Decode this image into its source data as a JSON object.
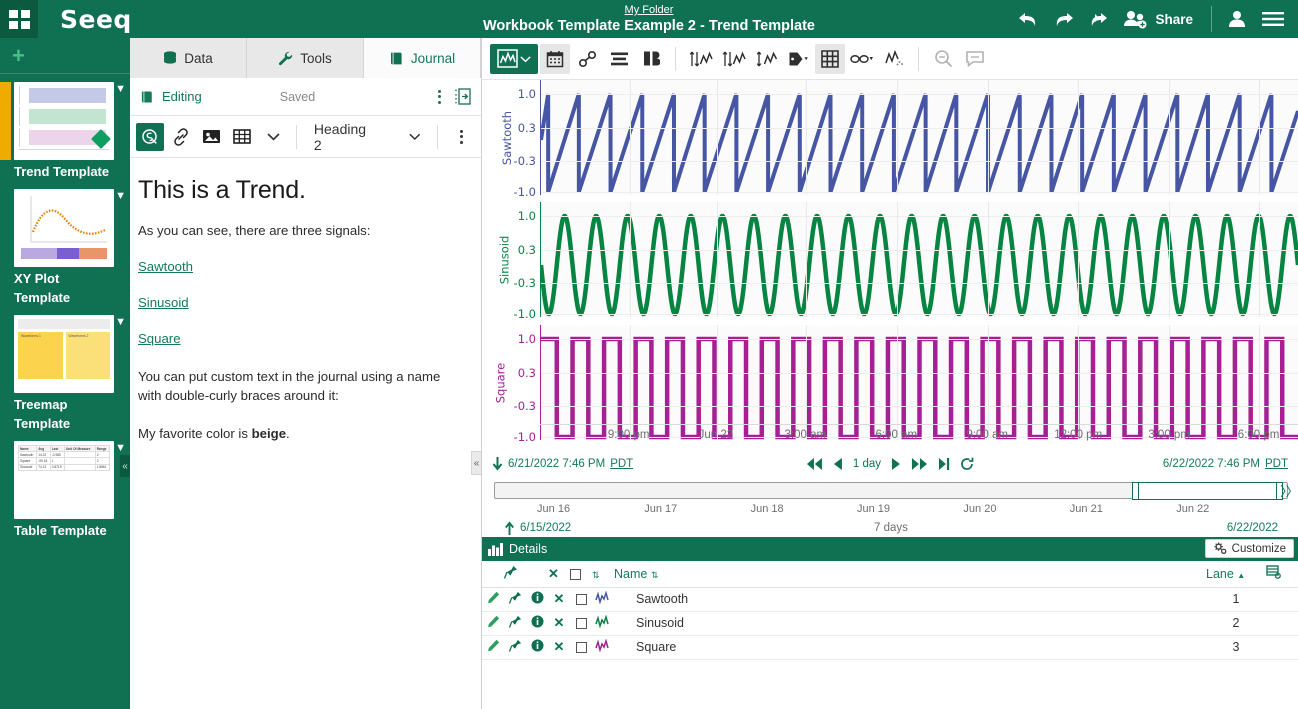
{
  "header": {
    "brand": "Seeq",
    "folder_link": "My Folder",
    "workbook_title": "Workbook Template Example 2 - Trend Template",
    "share_label": "Share",
    "icons": [
      "grid-icon",
      "undo-icon",
      "redo-icon",
      "redo-all-icon",
      "share-users-icon",
      "user-icon",
      "hamburger-icon"
    ]
  },
  "rail": {
    "add_label": "+",
    "templates": [
      {
        "label": "Trend Template",
        "active": true,
        "thumb": "trend"
      },
      {
        "label": "XY Plot Template",
        "active": false,
        "thumb": "xy"
      },
      {
        "label": "Treemap Template",
        "active": false,
        "thumb": "treemap"
      },
      {
        "label": "Table Template",
        "active": false,
        "thumb": "table"
      }
    ],
    "treemap_cells": [
      {
        "title": "Waveforms 1",
        "l1": "Sawtooth",
        "l2": "Waveform 1"
      },
      {
        "title": "Waveforms 2",
        "l1": "Sawtooth",
        "l2": "Waveform 10 V"
      }
    ],
    "table_thumb": {
      "headers": [
        "Name",
        "Avg",
        "Last",
        "Unit Of Measure",
        "Range"
      ],
      "rows": [
        [
          "Sawtooth",
          "14.22",
          "-0.985",
          "",
          "2"
        ],
        [
          "Square",
          "-99.18",
          "1",
          "",
          "2"
        ],
        [
          "Sinusoid",
          "74.13",
          "0.8719",
          "",
          "1.8861"
        ]
      ]
    }
  },
  "journal": {
    "tabs": [
      {
        "label": "Data",
        "icon": "database-icon",
        "active": false
      },
      {
        "label": "Tools",
        "icon": "wrench-icon",
        "active": false
      },
      {
        "label": "Journal",
        "icon": "book-icon",
        "active": true
      }
    ],
    "status": {
      "mode": "Editing",
      "saved": "Saved"
    },
    "toolbar": {
      "seeq_link_label": "seeq-link-icon",
      "heading_select": "Heading 2",
      "buttons": [
        "seeq-insert-icon",
        "link-icon",
        "image-icon",
        "table-icon",
        "chevron-down-icon",
        "kebab-icon"
      ]
    },
    "content": {
      "heading": "This is a Trend.",
      "intro": "As you can see, there are three signals:",
      "links": [
        "Sawtooth",
        "Sinusoid",
        "Square"
      ],
      "paragraph": "You can put custom text in the journal using a name with double-curly braces around it:",
      "favorite_prefix": "My favorite color is ",
      "favorite_value": "beige",
      "favorite_suffix": "."
    }
  },
  "chart_toolbar": {
    "buttons": [
      {
        "name": "view-mode",
        "icon": "trend-chart-icon",
        "state": "primary"
      },
      {
        "name": "calendar",
        "icon": "calendar-icon",
        "state": "normal"
      },
      {
        "name": "annotate-link",
        "icon": "paperclip-icon",
        "state": "normal"
      },
      {
        "name": "lanes",
        "icon": "stacked-lanes-icon",
        "state": "normal"
      },
      {
        "name": "compare",
        "icon": "compare-icon",
        "state": "normal"
      },
      {
        "name": "autoscale-1",
        "icon": "axis-updown-chart-icon",
        "state": "normal"
      },
      {
        "name": "autoscale-2",
        "icon": "axis-updown-chart-icon-2",
        "state": "normal"
      },
      {
        "name": "axis-align",
        "icon": "axis-height-icon",
        "state": "normal"
      },
      {
        "name": "labels",
        "icon": "tag-icon",
        "state": "normal"
      },
      {
        "name": "gridlines",
        "icon": "grid-icon",
        "state": "selected"
      },
      {
        "name": "dimming",
        "icon": "glasses-icon",
        "state": "normal"
      },
      {
        "name": "samples",
        "icon": "samples-icon",
        "state": "normal"
      },
      {
        "name": "zoom-out",
        "icon": "zoom-icon",
        "state": "dim"
      },
      {
        "name": "comment",
        "icon": "comment-icon",
        "state": "dim"
      }
    ]
  },
  "chart_data": {
    "type": "line",
    "title": "",
    "xlabel": "",
    "grid": true,
    "legend": "none",
    "x_tick_labels": [
      "9:00 pm",
      "Jun 22",
      "3:00 am",
      "6:00 am",
      "9:00 am",
      "12:00 pm",
      "3:00 pm",
      "6:00 pm"
    ],
    "y_tick_labels": [
      "1.0",
      "0.3",
      "-0.3",
      "-1.0"
    ],
    "ylim": [
      -1.0,
      1.0
    ],
    "lanes": [
      {
        "name": "Sawtooth",
        "color": "#4656a5",
        "waveform": "sawtooth",
        "cycles": 24,
        "amplitude": 1.0,
        "lane": 1
      },
      {
        "name": "Sinusoid",
        "color": "#068442",
        "waveform": "sine",
        "cycles": 24,
        "amplitude": 1.0,
        "lane": 2
      },
      {
        "name": "Square",
        "color": "#a61f95",
        "waveform": "square",
        "cycles": 24,
        "amplitude": 1.0,
        "lane": 3
      }
    ]
  },
  "timebar": {
    "start": "6/21/2022 7:46 PM",
    "start_tz": "PDT",
    "end": "6/22/2022 7:46 PM",
    "end_tz": "PDT",
    "duration": "1 day",
    "nav_icons": [
      "skip-back-icon",
      "step-back-icon",
      "play-icon",
      "step-forward-icon",
      "skip-forward-icon",
      "refresh-icon"
    ]
  },
  "rangebar": {
    "tick_labels": [
      "Jun 16",
      "Jun 17",
      "Jun 18",
      "Jun 19",
      "Jun 20",
      "Jun 21",
      "Jun 22"
    ],
    "start": "6/15/2022",
    "end": "6/22/2022",
    "span": "7 days",
    "selection_start_pct": 81,
    "selection_end_pct": 99
  },
  "details": {
    "title": "Details",
    "customize_label": "Customize",
    "columns": {
      "name": "Name",
      "lane": "Lane"
    },
    "rows": [
      {
        "name": "Sawtooth",
        "lane": "1",
        "color": "#4656a5"
      },
      {
        "name": "Sinusoid",
        "lane": "2",
        "color": "#068442"
      },
      {
        "name": "Square",
        "lane": "3",
        "color": "#a61f95"
      }
    ]
  }
}
